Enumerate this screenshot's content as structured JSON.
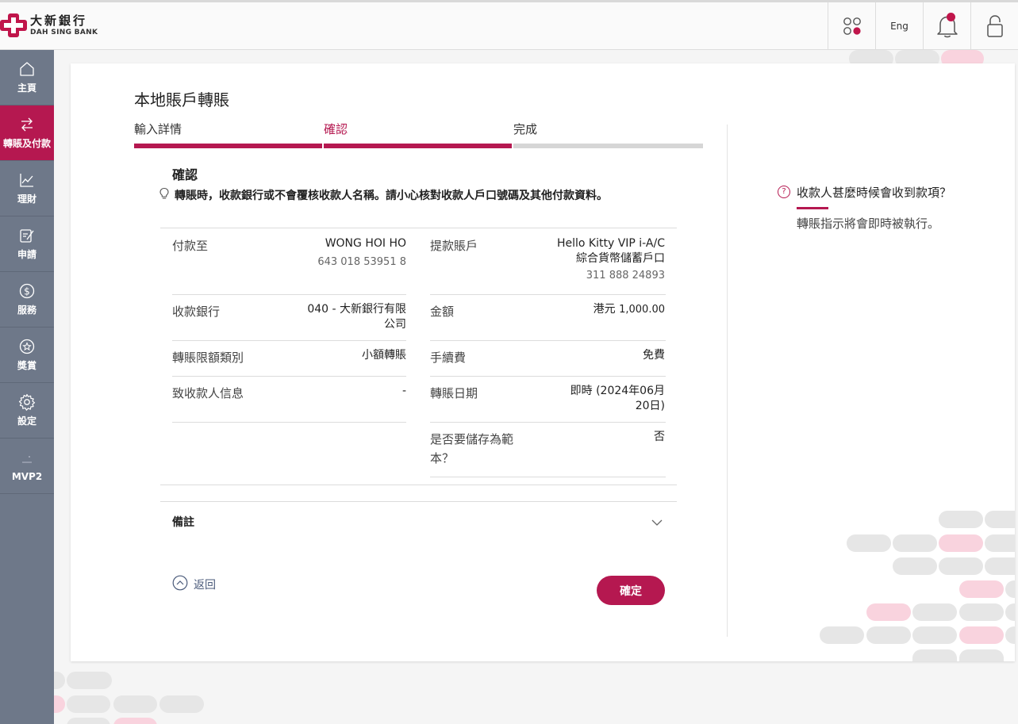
{
  "header": {
    "brand_cn": "大新銀行",
    "brand_en": "DAH SING BANK",
    "lang_label": "Eng"
  },
  "sidebar": {
    "items": [
      {
        "label": "主頁",
        "icon": "home-icon"
      },
      {
        "label": "轉賬及付款",
        "icon": "transfer-icon",
        "active": true
      },
      {
        "label": "理財",
        "icon": "chart-icon"
      },
      {
        "label": "申請",
        "icon": "form-icon"
      },
      {
        "label": "服務",
        "icon": "dollar-icon"
      },
      {
        "label": "獎賞",
        "icon": "star-icon"
      },
      {
        "label": "設定",
        "icon": "gear-icon"
      },
      {
        "label": "MVP2",
        "icon": "mvp-icon"
      }
    ]
  },
  "page": {
    "title": "本地賬戶轉賬",
    "steps": [
      {
        "label": "輸入詳情",
        "state": "done"
      },
      {
        "label": "確認",
        "state": "current"
      },
      {
        "label": "完成",
        "state": "pending"
      }
    ],
    "confirm_title": "確認",
    "notice": "轉賬時，收款銀行或不會覆核收款人名稱。請小心核對收款人戶口號碼及其他付款資料。"
  },
  "details": {
    "payee_label": "付款至",
    "payee_name": "WONG HOI HO",
    "payee_account": "643 018 53951 8",
    "from_label": "提款賬戶",
    "from_name": "Hello Kitty VIP i-A/C",
    "from_type": "綜合貨幣儲蓄戶口",
    "from_account": "311 888 24893",
    "bank_label": "收款銀行",
    "bank_value_1": "040 - 大新銀行有限",
    "bank_value_2": "公司",
    "amount_label": "金額",
    "amount_currency": "港元",
    "amount_value": "1,000.00",
    "limit_label": "轉賬限額類別",
    "limit_value": "小額轉賬",
    "fee_label": "手續費",
    "fee_value": "免費",
    "message_label": "致收款人信息",
    "message_value": "-",
    "date_label": "轉賬日期",
    "date_value_1": "即時 (2024年06月",
    "date_value_2": "20日)",
    "template_label_1": "是否要儲存為範",
    "template_label_2": "本？",
    "template_value": "否"
  },
  "remarks": {
    "label": "備註"
  },
  "actions": {
    "back_label": "返回",
    "confirm_label": "確定"
  },
  "help": {
    "question": "收款人甚麼時候會收到款項？",
    "answer": "轉賬指示將會即時被執行。"
  },
  "colors": {
    "brand": "#b51850",
    "sidebar": "#6e7889"
  }
}
